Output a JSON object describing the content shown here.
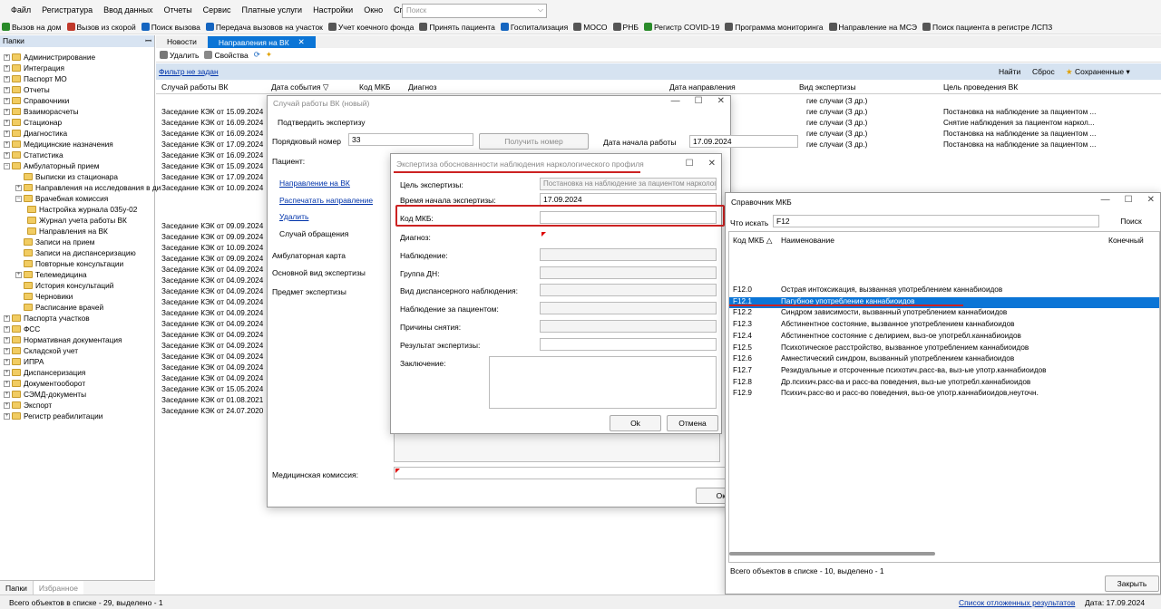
{
  "menu": [
    "Файл",
    "Регистратура",
    "Ввод данных",
    "Отчеты",
    "Сервис",
    "Платные услуги",
    "Настройки",
    "Окно",
    "Справка"
  ],
  "search_placeholder": "Поиск",
  "toolbar": [
    {
      "label": "Вызов на дом",
      "icon": "home-call-icon",
      "color": "#2a8b2a"
    },
    {
      "label": "Вызов из скорой",
      "icon": "ambulance-icon",
      "color": "#c0392b"
    },
    {
      "label": "Поиск вызова",
      "icon": "phone-search-icon",
      "color": "#1565c0"
    },
    {
      "label": "Передача вызовов на участок",
      "icon": "transfer-icon",
      "color": "#1565c0"
    },
    {
      "label": "Учет коечного фонда",
      "icon": "bed-fund-icon",
      "color": "#555"
    },
    {
      "label": "Принять пациента",
      "icon": "accept-patient-icon",
      "color": "#555"
    },
    {
      "label": "Госпитализация",
      "icon": "hospital-icon",
      "color": "#1565c0"
    },
    {
      "label": "МОСО",
      "icon": "moso-icon",
      "color": "#555"
    },
    {
      "label": "РНБ",
      "icon": "rnb-icon",
      "color": "#555"
    },
    {
      "label": "Регистр COVID-19",
      "icon": "covid-icon",
      "color": "#2a8b2a"
    },
    {
      "label": "Программа мониторинга",
      "icon": "monitoring-icon",
      "color": "#555"
    },
    {
      "label": "Направление на МСЭ",
      "icon": "mse-icon",
      "color": "#555"
    },
    {
      "label": "Поиск пациента в регистре ЛСПЗ",
      "icon": "register-search-icon",
      "color": "#555"
    }
  ],
  "left_panel": {
    "title": "Папки",
    "pin": "ꟷ",
    "tabs": [
      "Папки",
      "Избранное"
    ],
    "tree": [
      {
        "label": "Администрирование",
        "lvl": 0,
        "exp": "+"
      },
      {
        "label": "Интеграция",
        "lvl": 0,
        "exp": "+"
      },
      {
        "label": "Паспорт МО",
        "lvl": 0,
        "exp": "+"
      },
      {
        "label": "Отчеты",
        "lvl": 0,
        "exp": "+"
      },
      {
        "label": "Справочники",
        "lvl": 0,
        "exp": "+"
      },
      {
        "label": "Взаиморасчеты",
        "lvl": 0,
        "exp": "+"
      },
      {
        "label": "Стационар",
        "lvl": 0,
        "exp": "+"
      },
      {
        "label": "Диагностика",
        "lvl": 0,
        "exp": "+"
      },
      {
        "label": "Медицинские назначения",
        "lvl": 0,
        "exp": "+"
      },
      {
        "label": "Статистика",
        "lvl": 0,
        "exp": "+"
      },
      {
        "label": "Амбулаторный прием",
        "lvl": 0,
        "exp": "−"
      },
      {
        "label": "Выписки из стационара",
        "lvl": 1,
        "exp": ""
      },
      {
        "label": "Направления на исследования в ди",
        "lvl": 1,
        "exp": "+"
      },
      {
        "label": "Врачебная комиссия",
        "lvl": 1,
        "exp": "−"
      },
      {
        "label": "Настройка журнала 035у-02",
        "lvl": 2,
        "exp": ""
      },
      {
        "label": "Журнал учета работы ВК",
        "lvl": 2,
        "exp": ""
      },
      {
        "label": "Направления на ВК",
        "lvl": 2,
        "exp": ""
      },
      {
        "label": "Записи на прием",
        "lvl": 1,
        "exp": ""
      },
      {
        "label": "Записи на диспансеризацию",
        "lvl": 1,
        "exp": ""
      },
      {
        "label": "Повторные консультации",
        "lvl": 1,
        "exp": ""
      },
      {
        "label": "Телемедицина",
        "lvl": 1,
        "exp": "+"
      },
      {
        "label": "История консультаций",
        "lvl": 1,
        "exp": ""
      },
      {
        "label": "Черновики",
        "lvl": 1,
        "exp": ""
      },
      {
        "label": "Расписание врачей",
        "lvl": 1,
        "exp": ""
      },
      {
        "label": "Паспорта участков",
        "lvl": 0,
        "exp": "+"
      },
      {
        "label": "ФСС",
        "lvl": 0,
        "exp": "+"
      },
      {
        "label": "Нормативная документация",
        "lvl": 0,
        "exp": "+"
      },
      {
        "label": "Складской учет",
        "lvl": 0,
        "exp": "+"
      },
      {
        "label": "ИПРА",
        "lvl": 0,
        "exp": "+"
      },
      {
        "label": "Диспансеризация",
        "lvl": 0,
        "exp": "+"
      },
      {
        "label": "Документооборот",
        "lvl": 0,
        "exp": "+"
      },
      {
        "label": "СЭМД-документы",
        "lvl": 0,
        "exp": "+"
      },
      {
        "label": "Экспорт",
        "lvl": 0,
        "exp": "+"
      },
      {
        "label": "Регистр реабилитации",
        "lvl": 0,
        "exp": "+"
      }
    ]
  },
  "doc_tabs": [
    "Новости",
    "Направления на ВК"
  ],
  "sub_toolbar": {
    "delete": "Удалить",
    "props": "Свойства"
  },
  "filter": {
    "label": "Фильтр не задан",
    "find": "Найти",
    "reset": "Сброс",
    "saved": "Сохраненные"
  },
  "grid": {
    "headers": [
      "Случай работы ВК",
      "Дата события",
      "Код МКБ",
      "Диагноз",
      "Дата направления",
      "Вид экспертизы",
      "Цель проведения ВК"
    ],
    "col1": [
      "Заседание КЭК от 15.09.2024",
      "Заседание КЭК от 16.09.2024",
      "Заседание КЭК от 16.09.2024",
      "Заседание КЭК от 17.09.2024",
      "Заседание КЭК от 16.09.2024",
      "Заседание КЭК от 15.09.2024",
      "Заседание КЭК от 17.09.2024",
      "Заседание КЭК от 10.09.2024",
      "",
      "",
      "",
      "Заседание КЭК от 09.09.2024",
      "Заседание КЭК от 09.09.2024",
      "Заседание КЭК от 10.09.2024",
      "Заседание КЭК от 09.09.2024",
      "Заседание КЭК от 04.09.2024",
      "Заседание КЭК от 04.09.2024",
      "Заседание КЭК от 04.09.2024",
      "Заседание КЭК от 04.09.2024",
      "Заседание КЭК от 04.09.2024",
      "Заседание КЭК от 04.09.2024",
      "Заседание КЭК от 04.09.2024",
      "Заседание КЭК от 04.09.2024",
      "Заседание КЭК от 04.09.2024",
      "Заседание КЭК от 04.09.2024",
      "Заседание КЭК от 04.09.2024",
      "Заседание КЭК от 15.05.2024",
      "Заседание КЭК от 01.08.2021",
      "Заседание КЭК от 24.07.2020"
    ],
    "col_vid": [
      "гие случаи (З др.)",
      "гие случаи (З др.)",
      "гие случаи (З др.)",
      "гие случаи (З др.)",
      "гие случаи (З др.)"
    ],
    "col_goal": [
      "",
      "Постановка на наблюдение за пациентом ...",
      "Снятие наблюдения за пациентом наркол...",
      "Постановка на наблюдение за пациентом ...",
      "Постановка на наблюдение за пациентом ..."
    ]
  },
  "vk_window": {
    "title": "Случай работы ВК (новый)",
    "confirm": "Подтвердить экспертизу",
    "num_label": "Порядковый номер",
    "num_value": "33",
    "get_num": "Получить номер",
    "start_label": "Дата начала работы",
    "start_value": "17.09.2024",
    "patient_label": "Пациент:",
    "links": [
      "Направление на ВК",
      "Распечатать направление",
      "Удалить"
    ],
    "case_label": "Случай обращения",
    "amb_card": "Амбулаторная карта",
    "main_kind": "Основной вид экспертизы",
    "subject": "Предмет экспертизы",
    "commission": "Медицинская комиссия:",
    "ok": "Ок"
  },
  "expert_window": {
    "title": "Экспертиза обоснованности наблюдения наркологического профиля",
    "goal_label": "Цель экспертизы:",
    "goal_value": "Постановка на наблюдение за пациентом наркологического про",
    "time_label": "Время начала экспертизы:",
    "time_value": "17.09.2024",
    "mkb_label": "Код МКБ:",
    "mkb_value": "",
    "diag_label": "Диагноз:",
    "obs_label": "Наблюдение:",
    "group_label": "Группа ДН:",
    "kind_label": "Вид диспансерного наблюдения:",
    "pat_obs_label": "Наблюдение за пациентом:",
    "reasons_label": "Причины снятия:",
    "result_label": "Результат экспертизы:",
    "conclusion_label": "Заключение:",
    "ok": "Ok",
    "cancel": "Отмена"
  },
  "mkb_window": {
    "title": "Справочник МКБ",
    "search_label": "Что искать",
    "search_value": "F12",
    "search_btn": "Поиск",
    "headers": [
      "Код МКБ",
      "Наименование",
      "Конечный"
    ],
    "rows": [
      {
        "code": "F12.0",
        "name": "Острая интоксикация, вызванная употреблением каннабиоидов"
      },
      {
        "code": "F12.1",
        "name": "Пагубное употребление каннабиоидов"
      },
      {
        "code": "F12.2",
        "name": "Синдром зависимости, вызванный употреблением каннабиоидов"
      },
      {
        "code": "F12.3",
        "name": "Абстинентное состояние, вызванное употреблением каннабиоидов"
      },
      {
        "code": "F12.4",
        "name": "Абстинентное состояние с делирием, выз-ое употребл.каннабиоидов"
      },
      {
        "code": "F12.5",
        "name": "Психотическое расстройство, вызванное употреблением каннабиоидов"
      },
      {
        "code": "F12.6",
        "name": "Амнестический синдром, вызванный употреблением каннабиоидов"
      },
      {
        "code": "F12.7",
        "name": "Резидуальные и отсроченные психотич.расс-ва, выз-ые употр.каннабиоидов"
      },
      {
        "code": "F12.8",
        "name": "Др.психич.расс-ва и расс-ва поведения, выз-ые употребл.каннабиоидов"
      },
      {
        "code": "F12.9",
        "name": "Психич.расс-во и расс-во поведения, выз-ое употр.каннабиоидов,неуточн."
      }
    ],
    "selected": 1,
    "footer": "Всего объектов в списке - 10, выделено - 1",
    "close": "Закрыть"
  },
  "status": {
    "left": "Всего объектов в списке - 29, выделено - 1",
    "deferred": "Список отложенных результатов",
    "date": "Дата: 17.09.2024"
  },
  "colors": {
    "accent": "#0b75d6",
    "annotation": "#cc2222",
    "filter_bg": "#d6e3f1"
  }
}
